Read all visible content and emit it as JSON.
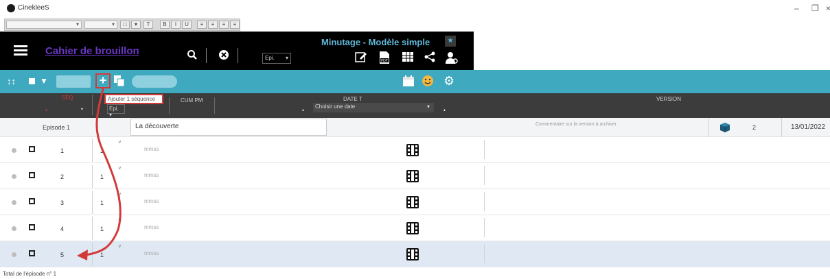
{
  "app": {
    "title": "CinekleeS"
  },
  "header": {
    "notebook_title": "Cahier de brouillon",
    "episode_select": "Epi.",
    "mode_title": "Minutage - Modèle simple"
  },
  "toolbar": {
    "tooltip": "Ajouter 1 séquence"
  },
  "columns": {
    "seq": "SEQ",
    "epi": "Epi.",
    "cum_pm": "CUM PM",
    "date_t": "DATE T",
    "date_placeholder": "Choisir une date",
    "version": "VERSION"
  },
  "episode": {
    "name": "Episode 1",
    "title": "La découverte",
    "comment": "Commentaire sur la version à archiver",
    "version": "2",
    "date": "13/01/2022"
  },
  "rows": [
    {
      "num": "1",
      "ep": "1",
      "time": "mmss"
    },
    {
      "num": "2",
      "ep": "1",
      "time": "mmss"
    },
    {
      "num": "3",
      "ep": "1",
      "time": "mmss"
    },
    {
      "num": "4",
      "ep": "1",
      "time": "mmss"
    },
    {
      "num": "5",
      "ep": "1",
      "time": "mmss"
    }
  ],
  "footer": {
    "total": "Total de l'épisode n° 1"
  },
  "colors": {
    "teal": "#3fa9bf",
    "accent_purple": "#6b36c6",
    "annotation_red": "#d23a3a"
  },
  "icons": [
    "search-icon",
    "close-circle-icon",
    "edit-icon",
    "pdf-icon",
    "table-icon",
    "share-icon",
    "users-icon",
    "calendar-icon",
    "smiley-icon",
    "gear-icon",
    "film-icon",
    "archive-box-icon",
    "plus-icon",
    "copy-icon"
  ]
}
